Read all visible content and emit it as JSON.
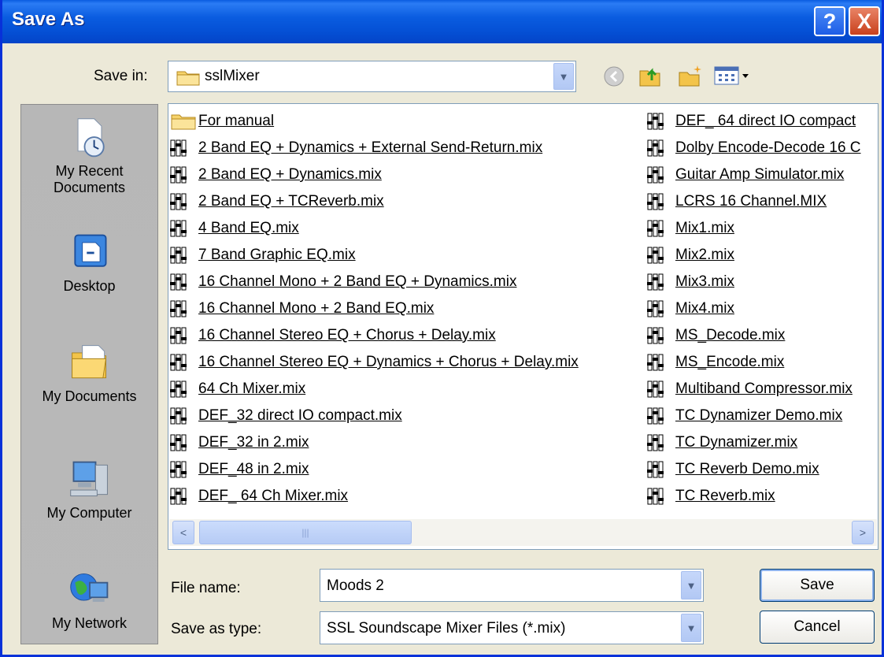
{
  "window": {
    "title": "Save As",
    "help_glyph": "?",
    "close_glyph": "X"
  },
  "save_in": {
    "label": "Save in:",
    "value": "sslMixer"
  },
  "toolbar_icons": [
    "back-icon",
    "up-folder-icon",
    "new-folder-icon",
    "view-menu-icon"
  ],
  "places": [
    {
      "label1": "My Recent",
      "label2": "Documents",
      "icon": "my-recent-documents-icon"
    },
    {
      "label1": "Desktop",
      "label2": "",
      "icon": "desktop-icon"
    },
    {
      "label1": "My Documents",
      "label2": "",
      "icon": "my-documents-icon"
    },
    {
      "label1": "My Computer",
      "label2": "",
      "icon": "my-computer-icon"
    },
    {
      "label1": "My Network",
      "label2": "",
      "icon": "my-network-icon"
    }
  ],
  "files_col1": [
    "For manual",
    "2 Band EQ + Dynamics + External Send-Return.mix",
    "2 Band EQ + Dynamics.mix",
    "2 Band EQ + TCReverb.mix",
    "4 Band EQ.mix",
    "7 Band Graphic EQ.mix",
    "16 Channel Mono + 2 Band EQ + Dynamics.mix",
    "16 Channel Mono + 2 Band EQ.mix",
    "16 Channel Stereo EQ + Chorus + Delay.mix",
    "16 Channel Stereo EQ + Dynamics + Chorus + Delay.mix",
    "64 Ch Mixer.mix",
    "DEF_32 direct IO compact.mix",
    "DEF_32 in 2.mix",
    "DEF_48 in 2.mix",
    "DEF_ 64 Ch Mixer.mix"
  ],
  "files_col2": [
    "DEF_ 64 direct IO compact",
    "Dolby Encode-Decode 16 C",
    "Guitar Amp Simulator.mix",
    "LCRS 16 Channel.MIX",
    "Mix1.mix",
    "Mix2.mix",
    "Mix3.mix",
    "Mix4.mix",
    "MS_Decode.mix",
    "MS_Encode.mix",
    "Multiband Compressor.mix",
    "TC Dynamizer Demo.mix",
    "TC Dynamizer.mix",
    "TC Reverb Demo.mix",
    "TC Reverb.mix"
  ],
  "scroll": {
    "left_arrow": "<",
    "right_arrow": ">",
    "thumb_grip": "|||"
  },
  "file_name": {
    "label": "File name:",
    "value": "Moods 2"
  },
  "save_as_type": {
    "label": "Save as type:",
    "value": "SSL Soundscape Mixer Files (*.mix)"
  },
  "buttons": {
    "save": "Save",
    "cancel": "Cancel"
  },
  "combo_arrow": "▼"
}
